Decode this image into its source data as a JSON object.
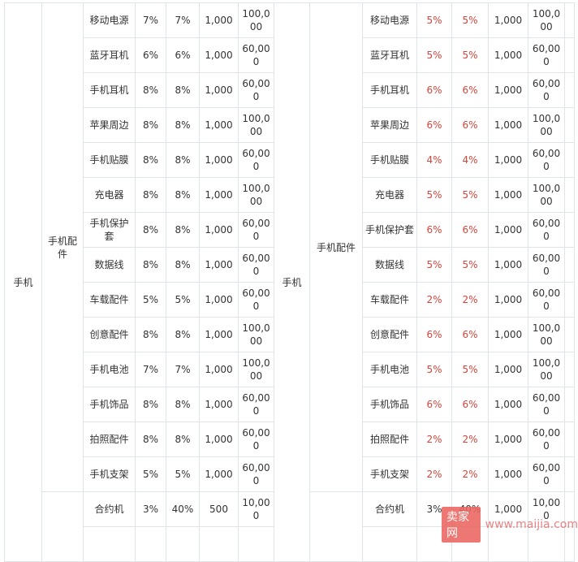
{
  "left_table": {
    "category": "手机",
    "subcategory": "手机配件",
    "rows": [
      {
        "name": "移动电源",
        "c1": "7%",
        "c2": "7%",
        "deposit": "1,000",
        "cap": "100,000"
      },
      {
        "name": "蓝牙耳机",
        "c1": "6%",
        "c2": "6%",
        "deposit": "1,000",
        "cap": "60,000"
      },
      {
        "name": "手机耳机",
        "c1": "8%",
        "c2": "8%",
        "deposit": "1,000",
        "cap": "60,000"
      },
      {
        "name": "苹果周边",
        "c1": "8%",
        "c2": "8%",
        "deposit": "1,000",
        "cap": "100,000"
      },
      {
        "name": "手机贴膜",
        "c1": "8%",
        "c2": "8%",
        "deposit": "1,000",
        "cap": "60,000"
      },
      {
        "name": "充电器",
        "c1": "8%",
        "c2": "8%",
        "deposit": "1,000",
        "cap": "100,000"
      },
      {
        "name": "手机保护套",
        "c1": "8%",
        "c2": "8%",
        "deposit": "1,000",
        "cap": "60,000"
      },
      {
        "name": "数据线",
        "c1": "8%",
        "c2": "8%",
        "deposit": "1,000",
        "cap": "60,000"
      },
      {
        "name": "车载配件",
        "c1": "5%",
        "c2": "5%",
        "deposit": "1,000",
        "cap": "60,000"
      },
      {
        "name": "创意配件",
        "c1": "8%",
        "c2": "8%",
        "deposit": "1,000",
        "cap": "100,000"
      },
      {
        "name": "手机电池",
        "c1": "7%",
        "c2": "7%",
        "deposit": "1,000",
        "cap": "100,000"
      },
      {
        "name": "手机饰品",
        "c1": "8%",
        "c2": "8%",
        "deposit": "1,000",
        "cap": "60,000"
      },
      {
        "name": "拍照配件",
        "c1": "8%",
        "c2": "8%",
        "deposit": "1,000",
        "cap": "60,000"
      },
      {
        "name": "手机支架",
        "c1": "5%",
        "c2": "5%",
        "deposit": "1,000",
        "cap": "60,000"
      }
    ],
    "extra_row": {
      "name": "合约机",
      "c1": "3%",
      "c2": "40%",
      "deposit": "500",
      "cap": "10,000"
    }
  },
  "right_table": {
    "category": "手机",
    "subcategory": "手机配件",
    "rows": [
      {
        "name": "移动电源",
        "c1": "5%",
        "c2": "5%",
        "deposit": "1,000",
        "cap": "100,000"
      },
      {
        "name": "蓝牙耳机",
        "c1": "5%",
        "c2": "5%",
        "deposit": "1,000",
        "cap": "60,000"
      },
      {
        "name": "手机耳机",
        "c1": "6%",
        "c2": "6%",
        "deposit": "1,000",
        "cap": "60,000"
      },
      {
        "name": "苹果周边",
        "c1": "6%",
        "c2": "6%",
        "deposit": "1,000",
        "cap": "100,000"
      },
      {
        "name": "手机贴膜",
        "c1": "4%",
        "c2": "4%",
        "deposit": "1,000",
        "cap": "60,000"
      },
      {
        "name": "充电器",
        "c1": "5%",
        "c2": "5%",
        "deposit": "1,000",
        "cap": "100,000"
      },
      {
        "name": "手机保护套",
        "c1": "6%",
        "c2": "6%",
        "deposit": "1,000",
        "cap": "60,000"
      },
      {
        "name": "数据线",
        "c1": "5%",
        "c2": "5%",
        "deposit": "1,000",
        "cap": "60,000"
      },
      {
        "name": "车载配件",
        "c1": "2%",
        "c2": "2%",
        "deposit": "1,000",
        "cap": "60,000"
      },
      {
        "name": "创意配件",
        "c1": "6%",
        "c2": "6%",
        "deposit": "1,000",
        "cap": "100,000"
      },
      {
        "name": "手机电池",
        "c1": "5%",
        "c2": "5%",
        "deposit": "1,000",
        "cap": "100,000"
      },
      {
        "name": "手机饰品",
        "c1": "6%",
        "c2": "6%",
        "deposit": "1,000",
        "cap": "60,000"
      },
      {
        "name": "拍照配件",
        "c1": "2%",
        "c2": "2%",
        "deposit": "1,000",
        "cap": "60,000"
      },
      {
        "name": "手机支架",
        "c1": "2%",
        "c2": "2%",
        "deposit": "1,000",
        "cap": "60,000"
      }
    ],
    "extra_row": {
      "name": "合约机",
      "c1": "3%",
      "c2": "40%",
      "deposit": "1,000",
      "cap": "10,000"
    }
  },
  "colors": {
    "highlight": "#d2453c",
    "border": "#dde4ea"
  },
  "watermark": {
    "badge": "卖家网",
    "url": "www.maijia.com"
  }
}
